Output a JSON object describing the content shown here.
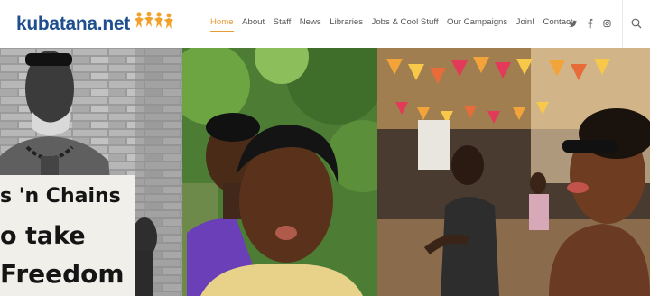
{
  "site": {
    "logo_text": "kubatana.net"
  },
  "nav": {
    "items": [
      {
        "label": "Home",
        "active": true
      },
      {
        "label": "About",
        "active": false
      },
      {
        "label": "Staff",
        "active": false
      },
      {
        "label": "News",
        "active": false
      },
      {
        "label": "Libraries",
        "active": false
      },
      {
        "label": "Jobs & Cool Stuff",
        "active": false
      },
      {
        "label": "Our Campaigns",
        "active": false
      },
      {
        "label": "Join!",
        "active": false
      },
      {
        "label": "Contact",
        "active": false
      }
    ]
  },
  "social": {
    "icons": [
      "twitter-icon",
      "facebook-icon",
      "instagram-icon"
    ]
  },
  "colors": {
    "brand_blue": "#1f4f8e",
    "accent_orange": "#e79b35",
    "nav_text": "#555555"
  },
  "hero": {
    "sign_lines": [
      "s 'n Chains",
      "o take",
      "Freedom"
    ]
  }
}
